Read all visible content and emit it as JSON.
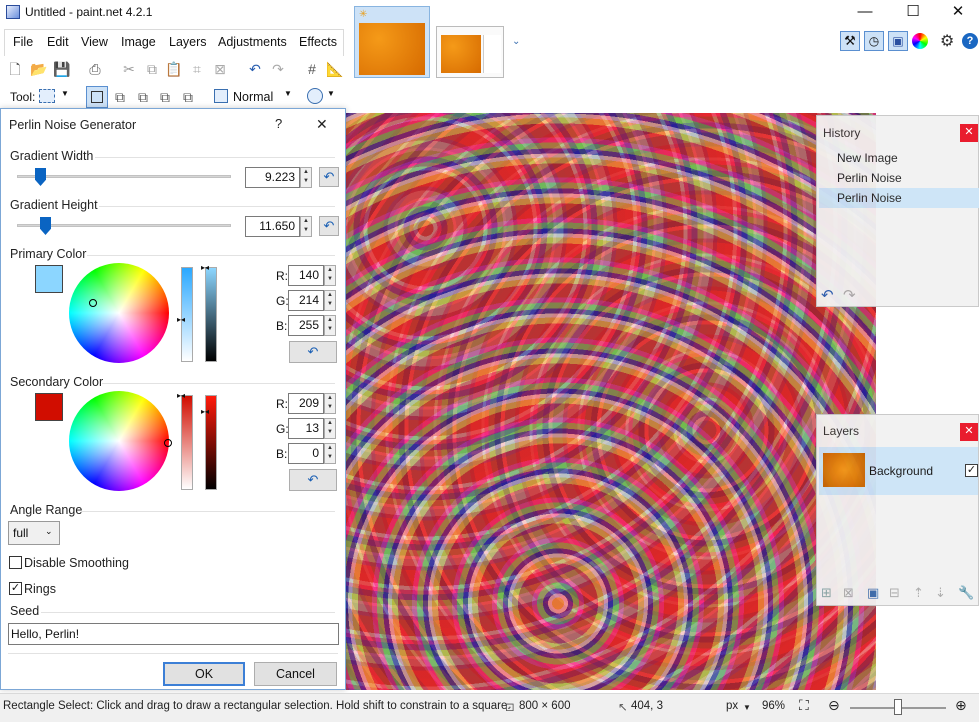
{
  "window": {
    "title": "Untitled - paint.net 4.2.1"
  },
  "menu": [
    "File",
    "Edit",
    "View",
    "Image",
    "Layers",
    "Adjustments",
    "Effects"
  ],
  "toolbar": {
    "tool_label": "Tool:",
    "blend_mode": "Normal"
  },
  "dialog": {
    "title": "Perlin Noise Generator",
    "help": "?",
    "close": "✕",
    "gradient_width": {
      "label": "Gradient Width",
      "value": "9.223"
    },
    "gradient_height": {
      "label": "Gradient Height",
      "value": "11.650"
    },
    "primary": {
      "label": "Primary Color",
      "r": "140",
      "g": "214",
      "b": "255",
      "hex": "#8cd6ff"
    },
    "secondary": {
      "label": "Secondary Color",
      "r": "209",
      "g": "13",
      "b": "0",
      "hex": "#d10d00"
    },
    "channel_labels": {
      "r": "R:",
      "g": "G:",
      "b": "B:"
    },
    "angle_range": {
      "label": "Angle Range",
      "value": "full"
    },
    "disable_smoothing": {
      "label": "Disable Smoothing",
      "checked": false
    },
    "rings": {
      "label": "Rings",
      "checked": true
    },
    "seed": {
      "label": "Seed",
      "value": "Hello, Perlin!"
    },
    "ok": "OK",
    "cancel": "Cancel"
  },
  "history": {
    "title": "History",
    "items": [
      "New Image",
      "Perlin Noise",
      "Perlin Noise"
    ]
  },
  "layers": {
    "title": "Layers",
    "items": [
      {
        "name": "Background",
        "visible": true
      }
    ]
  },
  "status": {
    "hint": "Rectangle Select: Click and drag to draw a rectangular selection. Hold shift to constrain to a square.",
    "image_size": "800 × 600",
    "cursor": "404, 3",
    "unit": "px",
    "zoom": "96%"
  },
  "background_hint": "\\Users\\kriie\\Desktop\\Code\\paint.net-truefix2"
}
